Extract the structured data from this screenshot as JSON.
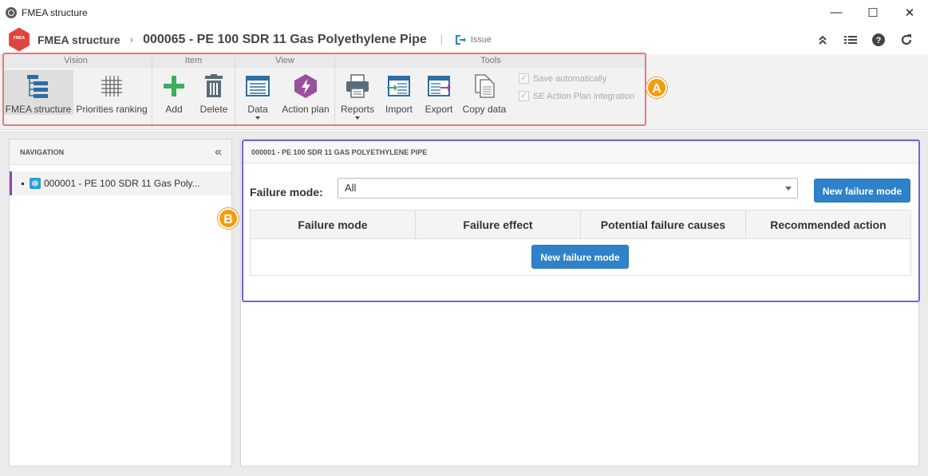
{
  "window": {
    "title": "FMEA structure",
    "minimize": "—",
    "maximize": "☐",
    "close": "✕"
  },
  "header": {
    "logo_text": "FMEA",
    "crumb_root": "FMEA structure",
    "crumb_separator": "›",
    "crumb_current": "000065 - PE 100 SDR 11 Gas Polyethylene Pipe",
    "issue_label": "Issue",
    "icons": [
      "collapse-up-icon",
      "list-icon",
      "help-icon",
      "refresh-icon"
    ]
  },
  "ribbon": {
    "groups": [
      {
        "title": "Vision",
        "buttons": [
          {
            "label": "FMEA structure",
            "icon": "tree-structure-icon",
            "active": true
          },
          {
            "label": "Priorities ranking",
            "icon": "grid-icon"
          }
        ]
      },
      {
        "title": "Item",
        "buttons": [
          {
            "label": "Add",
            "icon": "plus-icon"
          },
          {
            "label": "Delete",
            "icon": "trash-icon"
          }
        ]
      },
      {
        "title": "View",
        "buttons": [
          {
            "label": "Data",
            "icon": "data-window-icon",
            "dropdown": true
          },
          {
            "label": "Action plan",
            "icon": "action-plan-icon"
          }
        ]
      },
      {
        "title": "Tools",
        "buttons": [
          {
            "label": "Reports",
            "icon": "printer-icon",
            "dropdown": true
          },
          {
            "label": "Import",
            "icon": "import-icon"
          },
          {
            "label": "Export",
            "icon": "export-icon"
          },
          {
            "label": "Copy data",
            "icon": "copy-icon"
          }
        ]
      }
    ],
    "checkboxes": [
      {
        "label": "Save automatically",
        "checked": true,
        "disabled": true
      },
      {
        "label": "SE Action Plan integration",
        "checked": true,
        "disabled": true
      }
    ]
  },
  "annotations": {
    "a": "A",
    "b": "B"
  },
  "navigation": {
    "title": "NAVIGATION",
    "collapse": "«",
    "items": [
      {
        "label": "000001 - PE 100 SDR 11 Gas Poly..."
      }
    ]
  },
  "content": {
    "title": "000001 - PE 100 SDR 11 GAS POLYETHYLENE PIPE",
    "failure_mode_label": "Failure mode:",
    "failure_mode_value": "All",
    "new_button": "New failure mode",
    "columns": [
      "Failure mode",
      "Failure effect",
      "Potential failure causes",
      "Recommended action"
    ],
    "empty_button": "New failure mode"
  },
  "colors": {
    "accent": "#2e82c9",
    "highlight_a": "#e8787a",
    "highlight_b": "#6b66e0",
    "badge": "#f39c12",
    "nav_marker": "#8e44ad"
  }
}
